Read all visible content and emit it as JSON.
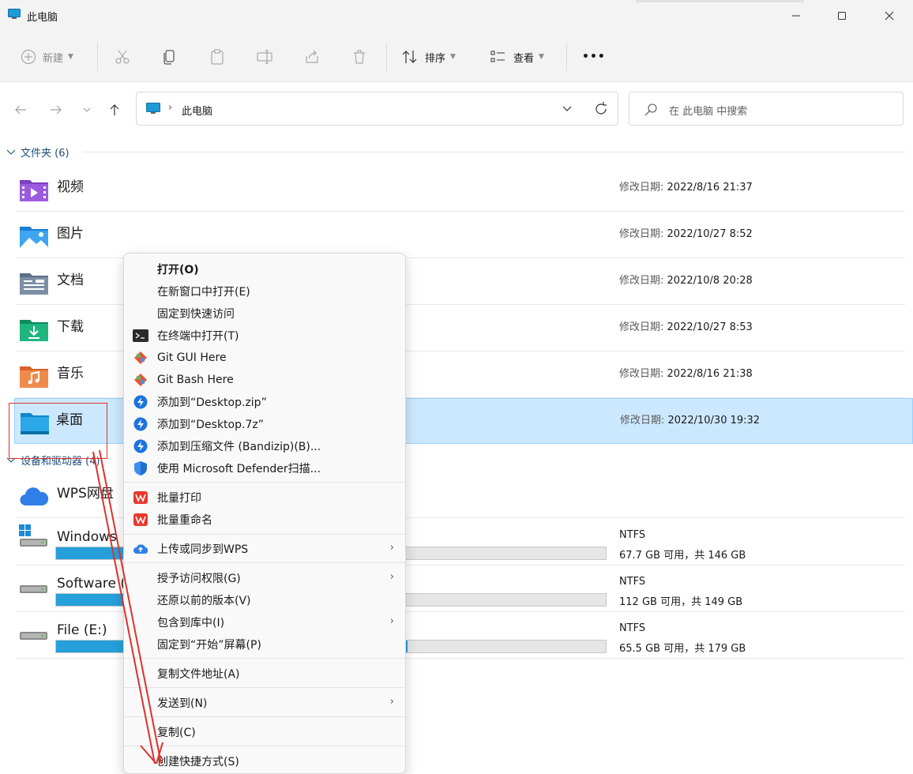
{
  "window": {
    "title": "此电脑",
    "minimize": "minimize",
    "maximize": "maximize",
    "close": "close"
  },
  "toolbar": {
    "new_label": "新建",
    "sort_label": "排序",
    "view_label": "查看",
    "more": "•••"
  },
  "address": {
    "path": "此电脑",
    "search_placeholder": "在 此电脑 中搜索"
  },
  "groups": {
    "folders_label": "文件夹 (6)",
    "devices_label": "设备和驱动器 (4)"
  },
  "folders": [
    {
      "name": "视频",
      "date_label": "修改日期:",
      "date": "2022/8/16 21:37",
      "icon": "video-folder-icon"
    },
    {
      "name": "图片",
      "date_label": "修改日期:",
      "date": "2022/10/27 8:52",
      "icon": "pictures-folder-icon"
    },
    {
      "name": "文档",
      "date_label": "修改日期:",
      "date": "2022/10/8 20:28",
      "icon": "documents-folder-icon"
    },
    {
      "name": "下载",
      "date_label": "修改日期:",
      "date": "2022/10/27 8:53",
      "icon": "downloads-folder-icon"
    },
    {
      "name": "音乐",
      "date_label": "修改日期:",
      "date": "2022/8/16 21:38",
      "icon": "music-folder-icon"
    },
    {
      "name": "桌面",
      "date_label": "修改日期:",
      "date": "2022/10/30 19:32",
      "icon": "desktop-folder-icon"
    }
  ],
  "drives": [
    {
      "name": "WPS网盘",
      "icon": "wps-cloud-icon"
    },
    {
      "name": "Windows",
      "fs": "NTFS",
      "space": "67.7 GB 可用，共 146 GB",
      "used_fraction": 0.54,
      "icon": "drive-icon"
    },
    {
      "name": "Software (",
      "fs": "NTFS",
      "space": "112 GB 可用，共 149 GB",
      "used_fraction": 0.25,
      "icon": "drive-icon"
    },
    {
      "name": "File (E:)",
      "fs": "NTFS",
      "space": "65.5 GB 可用，共 179 GB",
      "used_fraction": 0.64,
      "icon": "drive-icon"
    }
  ],
  "context_menu": {
    "items": [
      {
        "label": "打开(O)",
        "bold": true
      },
      {
        "label": "在新窗口中打开(E)"
      },
      {
        "label": "固定到快速访问"
      },
      {
        "label": "在终端中打开(T)",
        "icon": "terminal-icon"
      },
      {
        "label": "Git GUI Here",
        "icon": "git-icon"
      },
      {
        "label": "Git Bash Here",
        "icon": "git-icon"
      },
      {
        "label": "添加到“Desktop.zip”",
        "icon": "bandizip-icon"
      },
      {
        "label": "添加到“Desktop.7z”",
        "icon": "bandizip-icon"
      },
      {
        "label": "添加到压缩文件 (Bandizip)(B)...",
        "icon": "bandizip-icon"
      },
      {
        "label": "使用 Microsoft Defender扫描...",
        "icon": "defender-shield-icon"
      },
      {
        "label": "批量打印",
        "icon": "wps-icon"
      },
      {
        "label": "批量重命名",
        "icon": "wps-icon"
      },
      {
        "label": "上传或同步到WPS",
        "icon": "wps-cloud-upload-icon",
        "submenu": true
      },
      {
        "label": "授予访问权限(G)",
        "submenu": true
      },
      {
        "label": "还原以前的版本(V)"
      },
      {
        "label": "包含到库中(I)",
        "submenu": true
      },
      {
        "label": "固定到“开始”屏幕(P)"
      },
      {
        "label": "复制文件地址(A)"
      },
      {
        "label": "发送到(N)",
        "submenu": true
      },
      {
        "label": "复制(C)"
      },
      {
        "label": "创建快捷方式(S)"
      }
    ]
  },
  "colors": {
    "accent": "#0067c0",
    "selection": "#cce8ff",
    "drive_bar": "#26a0da",
    "annotation_red": "#e0302a"
  }
}
